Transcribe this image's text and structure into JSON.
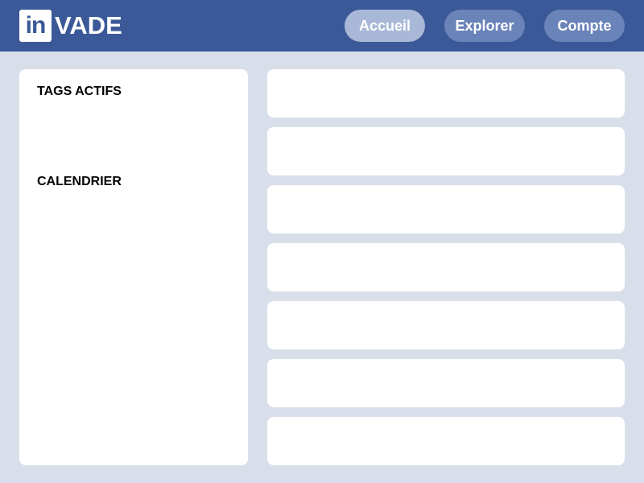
{
  "header": {
    "logo_mark": "in",
    "logo_text": "VADE",
    "nav": [
      {
        "label": "Accueil",
        "active": true
      },
      {
        "label": "Explorer",
        "active": false
      },
      {
        "label": "Compte",
        "active": false
      }
    ]
  },
  "sidebar": {
    "tags_title": "TAGS ACTIFS",
    "calendar_title": "CALENDRIER"
  },
  "feed": {
    "cards": [
      "",
      "",
      "",
      "",
      "",
      "",
      ""
    ]
  },
  "colors": {
    "header_bg": "#3b5998",
    "page_bg": "#d9dfea",
    "nav_active": "#a8b8d6",
    "nav_inactive": "#6a83b8"
  }
}
